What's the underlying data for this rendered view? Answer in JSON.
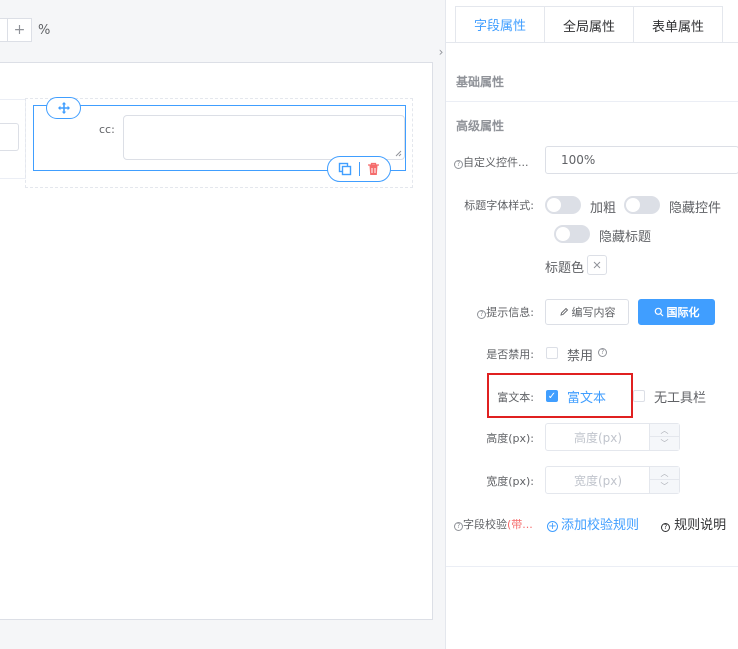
{
  "zoom": {
    "plus": "+",
    "unit": "%"
  },
  "canvas": {
    "field_label": "cc:"
  },
  "tabs": [
    {
      "label": "字段属性",
      "active": true
    },
    {
      "label": "全局属性",
      "active": false
    },
    {
      "label": "表单属性",
      "active": false
    }
  ],
  "sections": {
    "basic": "基础属性",
    "advanced": "高级属性"
  },
  "props": {
    "custom_width_label": "自定义控件...",
    "custom_width_value": "100%",
    "title_font_label": "标题字体样式:",
    "bold": "加粗",
    "hide_control": "隐藏控件",
    "hide_title": "隐藏标题",
    "title_color": "标题色",
    "tooltip_label": "提示信息:",
    "edit_content": "编写内容",
    "i18n": "国际化",
    "disabled_label": "是否禁用:",
    "disabled_option": "禁用",
    "rich_text_label": "富文本:",
    "rich_text_option": "富文本",
    "no_toolbar": "无工具栏",
    "height_label": "高度(px):",
    "height_placeholder": "高度(px)",
    "width_label": "宽度(px):",
    "width_placeholder": "宽度(px)",
    "validation_label": "字段校验",
    "validation_required": "(带...",
    "add_rule": "添加校验规则",
    "rule_help": "规则说明"
  },
  "colors": {
    "primary": "#409eff",
    "highlight": "#e02020"
  }
}
